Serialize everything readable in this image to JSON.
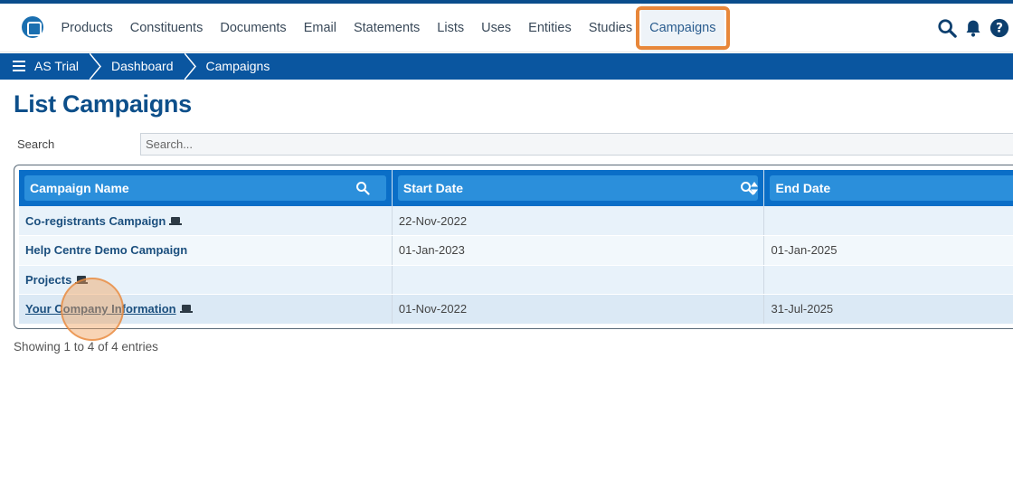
{
  "nav": {
    "items": [
      {
        "label": "Products"
      },
      {
        "label": "Constituents"
      },
      {
        "label": "Documents"
      },
      {
        "label": "Email"
      },
      {
        "label": "Statements"
      },
      {
        "label": "Lists"
      },
      {
        "label": "Uses"
      },
      {
        "label": "Entities"
      },
      {
        "label": "Studies"
      },
      {
        "label": "Campaigns"
      }
    ],
    "active": "Campaigns",
    "icons": [
      "search-icon",
      "bell-icon",
      "help-icon"
    ]
  },
  "breadcrumb": {
    "items": [
      "AS Trial",
      "Dashboard",
      "Campaigns"
    ],
    "icon": "menu-icon"
  },
  "page": {
    "title": "List Campaigns",
    "search_label": "Search",
    "search_placeholder": "Search...",
    "search_value": ""
  },
  "table": {
    "columns": [
      "Campaign Name",
      "Start Date",
      "End Date"
    ],
    "rows": [
      {
        "name": "Co-registrants Campaign",
        "start": "22-Nov-2022",
        "end": ""
      },
      {
        "name": "Help Centre Demo Campaign",
        "start": "01-Jan-2023",
        "end": "01-Jan-2025"
      },
      {
        "name": "Projects",
        "start": "",
        "end": ""
      },
      {
        "name": "Your Company Information",
        "start": "01-Nov-2022",
        "end": "31-Jul-2025"
      }
    ]
  },
  "info": "Showing 1 to 4 of 4 entries",
  "colors": {
    "brand": "#0a56a0",
    "header": "#0a6ec7",
    "highlight": "#e8873a",
    "title": "#0d4f8a"
  }
}
